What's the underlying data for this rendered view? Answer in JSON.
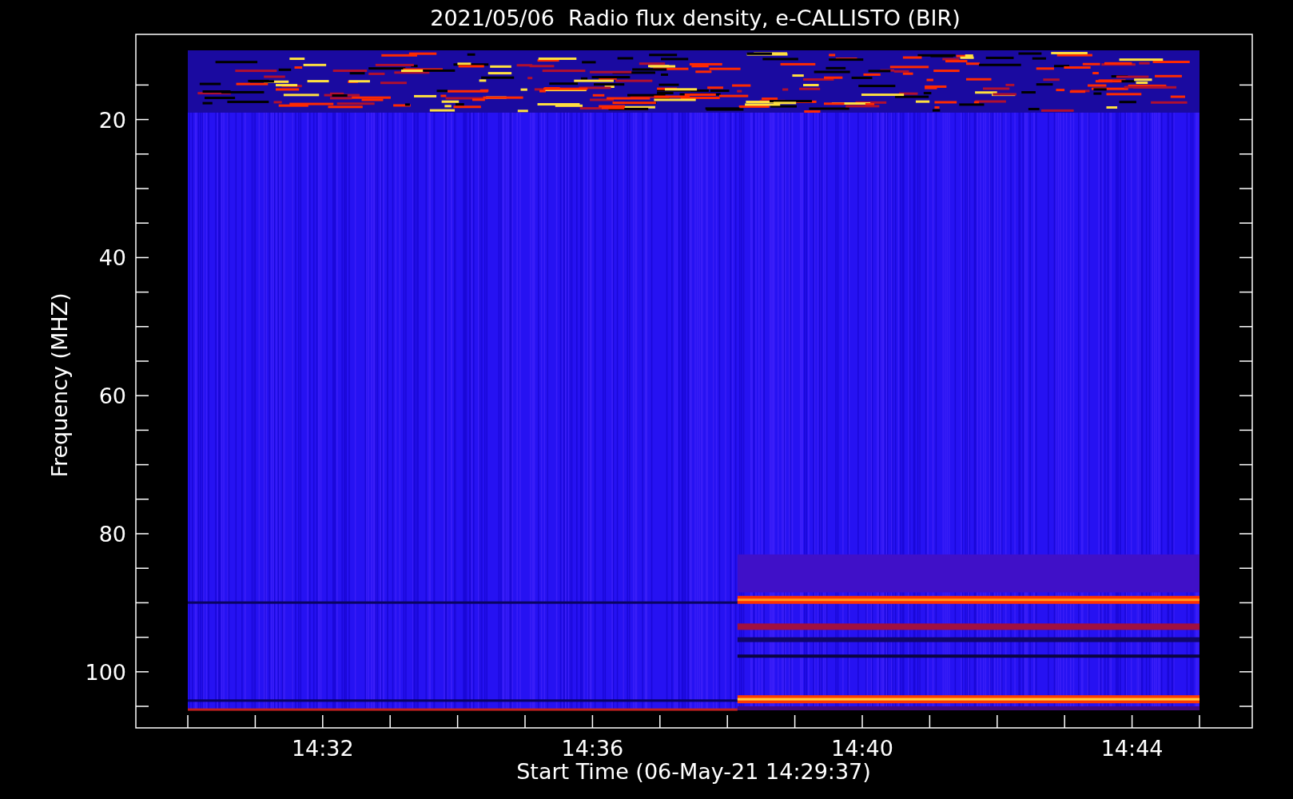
{
  "title": "2021/05/06  Radio flux density, e-CALLISTO (BIR)",
  "plot": {
    "ylabel": "Frequency (MHZ)",
    "xlabel": "Start Time (06-May-21 14:29:37)",
    "yticks": [
      "20",
      "40",
      "60",
      "80",
      "100"
    ],
    "xticks": [
      "14:32",
      "14:36",
      "14:40",
      "14:44"
    ]
  }
}
